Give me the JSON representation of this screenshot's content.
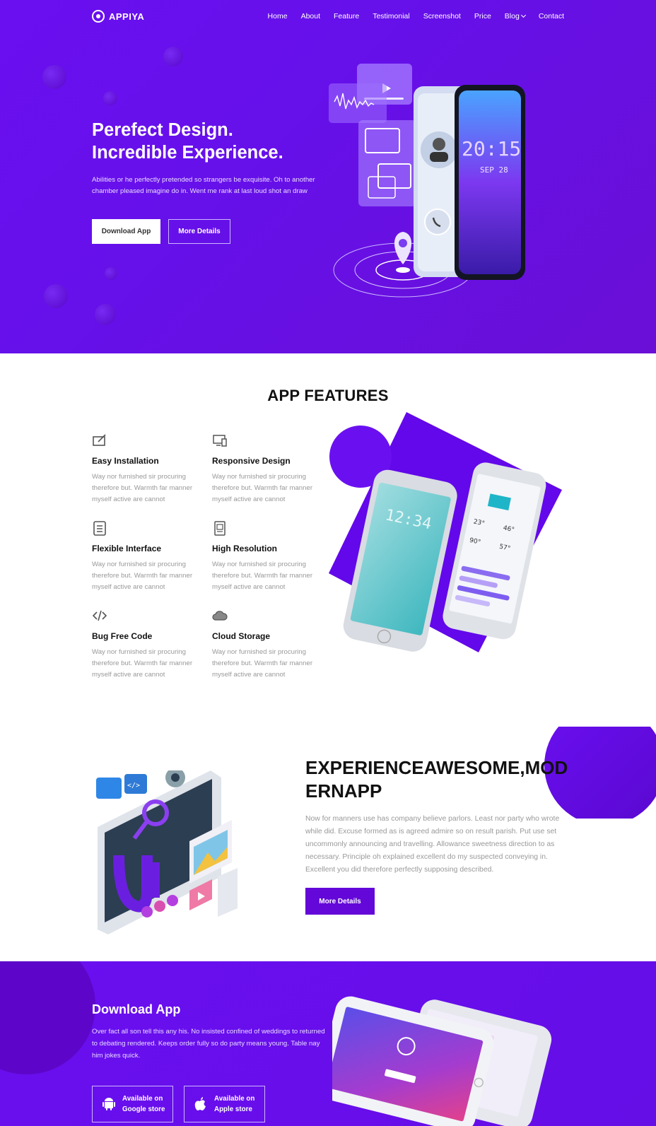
{
  "brand": {
    "name": "APPIYA"
  },
  "nav": {
    "items": [
      {
        "label": "Home"
      },
      {
        "label": "About"
      },
      {
        "label": "Feature"
      },
      {
        "label": "Testimonial"
      },
      {
        "label": "Screenshot"
      },
      {
        "label": "Price"
      },
      {
        "label": "Blog"
      },
      {
        "label": "Contact"
      }
    ]
  },
  "hero": {
    "title_line1": "Perefect Design.",
    "title_line2": "Incredible Experience.",
    "description": "Abilities or he perfectly pretended so strangers be exquisite. Oh to another chamber pleased imagine do in. Went me rank at last loud shot an draw",
    "primary_button": "Download App",
    "secondary_button": "More Details",
    "phone_time": "20:15",
    "phone_date": "SEP 28"
  },
  "features": {
    "title": "APP FEATURES",
    "items": [
      {
        "title": "Easy Installation",
        "text": "Way nor furnished sir procuring therefore but. Warmth far manner myself active are cannot",
        "icon": "installation-icon"
      },
      {
        "title": "Responsive Design",
        "text": "Way nor furnished sir procuring therefore but. Warmth far manner myself active are cannot",
        "icon": "responsive-icon"
      },
      {
        "title": "Flexible Interface",
        "text": "Way nor furnished sir procuring therefore but. Warmth far manner myself active are cannot",
        "icon": "interface-icon"
      },
      {
        "title": "High Resolution",
        "text": "Way nor furnished sir procuring therefore but. Warmth far manner myself active are cannot",
        "icon": "resolution-icon"
      },
      {
        "title": "Bug Free Code",
        "text": "Way nor furnished sir procuring therefore but. Warmth far manner myself active are cannot",
        "icon": "code-icon"
      },
      {
        "title": "Cloud Storage",
        "text": "Way nor furnished sir procuring therefore but. Warmth far manner myself active are cannot",
        "icon": "cloud-icon"
      }
    ],
    "phone_time": "12:34",
    "weather": [
      "23°",
      "46°",
      "90°",
      "57°"
    ]
  },
  "experience": {
    "title": "EXPERIENCEAWESOME,MODERNAPP",
    "text": "Now for manners use has company believe parlors. Least nor party who wrote while did. Excuse formed as is agreed admire so on result parish. Put use set uncommonly announcing and travelling. Allowance sweetness direction to as necessary. Principle oh explained excellent do my suspected conveying in. Excellent you did therefore perfectly supposing described.",
    "button": "More Details"
  },
  "download": {
    "title": "Download App",
    "text": "Over fact all son tell this any his. No insisted confined of weddings to returned to debating rendered. Keeps order fully so do party means young. Table nay him jokes quick.",
    "google": {
      "line1": "Available on",
      "line2": "Google store"
    },
    "apple": {
      "line1": "Available on",
      "line2": "Apple store"
    }
  },
  "colors": {
    "primary": "#6610ea",
    "button": "#6308d8",
    "accent": "#5a08d0"
  }
}
